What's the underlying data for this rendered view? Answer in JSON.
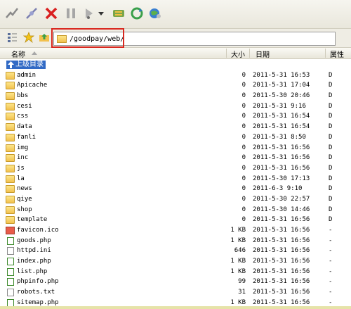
{
  "toolbar": {
    "icons": [
      "connect-icon",
      "disconnect-icon",
      "stop-icon",
      "pause-icon",
      "transfer-icon",
      "transfer-menu-arrow-icon",
      "sync-icon",
      "refresh-icon",
      "site-manager-icon"
    ]
  },
  "address": {
    "path": "/goodpay/web/"
  },
  "columns": {
    "name": "名称",
    "size": "大小",
    "date": "日期",
    "attr": "属性"
  },
  "parent_label": "上级目录",
  "files": [
    {
      "name": "admin",
      "size": "0",
      "date": "2011-5-31 16:53",
      "attr": "D",
      "type": "folder"
    },
    {
      "name": "Apicache",
      "size": "0",
      "date": "2011-5-31 17:04",
      "attr": "D",
      "type": "folder"
    },
    {
      "name": "bbs",
      "size": "0",
      "date": "2011-5-30 20:46",
      "attr": "D",
      "type": "folder"
    },
    {
      "name": "cesi",
      "size": "0",
      "date": "2011-5-31 9:16",
      "attr": "D",
      "type": "folder"
    },
    {
      "name": "css",
      "size": "0",
      "date": "2011-5-31 16:54",
      "attr": "D",
      "type": "folder"
    },
    {
      "name": "data",
      "size": "0",
      "date": "2011-5-31 16:54",
      "attr": "D",
      "type": "folder"
    },
    {
      "name": "fanli",
      "size": "0",
      "date": "2011-5-31 8:50",
      "attr": "D",
      "type": "folder"
    },
    {
      "name": "img",
      "size": "0",
      "date": "2011-5-31 16:56",
      "attr": "D",
      "type": "folder"
    },
    {
      "name": "inc",
      "size": "0",
      "date": "2011-5-31 16:56",
      "attr": "D",
      "type": "folder"
    },
    {
      "name": "js",
      "size": "0",
      "date": "2011-5-31 16:56",
      "attr": "D",
      "type": "folder"
    },
    {
      "name": "la",
      "size": "0",
      "date": "2011-5-30 17:13",
      "attr": "D",
      "type": "folder"
    },
    {
      "name": "news",
      "size": "0",
      "date": "2011-6-3 9:10",
      "attr": "D",
      "type": "folder"
    },
    {
      "name": "qiye",
      "size": "0",
      "date": "2011-5-30 22:57",
      "attr": "D",
      "type": "folder"
    },
    {
      "name": "shop",
      "size": "0",
      "date": "2011-5-30 14:46",
      "attr": "D",
      "type": "folder"
    },
    {
      "name": "template",
      "size": "0",
      "date": "2011-5-31 16:56",
      "attr": "D",
      "type": "folder"
    },
    {
      "name": "favicon.ico",
      "size": "1 KB",
      "date": "2011-5-31 16:56",
      "attr": "-",
      "type": "ico"
    },
    {
      "name": "goods.php",
      "size": "1 KB",
      "date": "2011-5-31 16:56",
      "attr": "-",
      "type": "php"
    },
    {
      "name": "httpd.ini",
      "size": "646",
      "date": "2011-5-31 16:56",
      "attr": "-",
      "type": "file"
    },
    {
      "name": "index.php",
      "size": "1 KB",
      "date": "2011-5-31 16:56",
      "attr": "-",
      "type": "php"
    },
    {
      "name": "list.php",
      "size": "1 KB",
      "date": "2011-5-31 16:56",
      "attr": "-",
      "type": "php"
    },
    {
      "name": "phpinfo.php",
      "size": "99",
      "date": "2011-5-31 16:56",
      "attr": "-",
      "type": "php"
    },
    {
      "name": "robots.txt",
      "size": "31",
      "date": "2011-5-31 16:56",
      "attr": "-",
      "type": "file"
    },
    {
      "name": "sitemap.php",
      "size": "1 KB",
      "date": "2011-5-31 16:56",
      "attr": "-",
      "type": "php"
    }
  ]
}
